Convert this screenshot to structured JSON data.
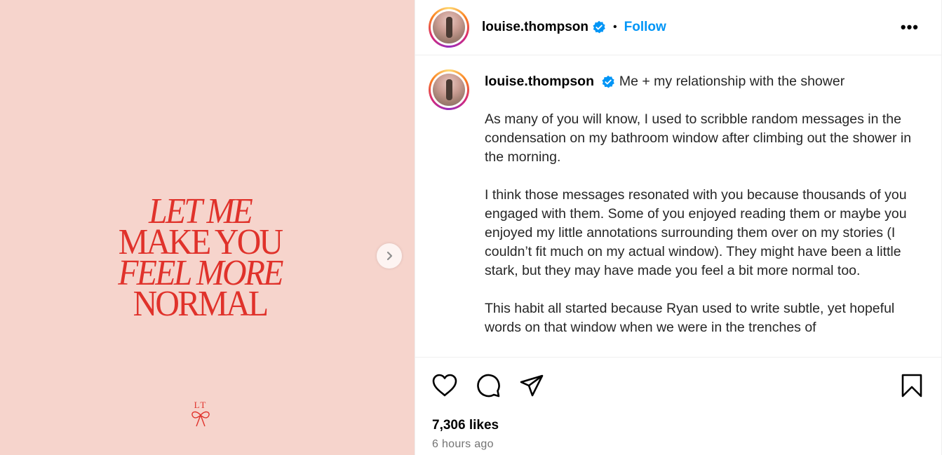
{
  "media": {
    "headline_lines": [
      "LET ME",
      "MAKE YOU",
      "FEEL MORE",
      "NORMAL"
    ],
    "monogram": "LT",
    "colors": {
      "background": "#f6d4cc",
      "text": "#e0322b"
    },
    "next_icon": "chevron-right-icon"
  },
  "header": {
    "username": "louise.thompson",
    "verified_icon": "verified-badge-icon",
    "separator": "•",
    "follow_label": "Follow",
    "more_label": "•••"
  },
  "caption": {
    "username": "louise.thompson",
    "title": "Me + my relationship with the shower",
    "paragraphs": [
      "As many of you will know, I used to scribble random messages in the condensation on my bathroom window after climbing out the shower in the morning.",
      "I think those messages resonated with you because thousands of you engaged with them. Some of you enjoyed reading them or maybe you enjoyed my little annotations surrounding them over on my stories (I couldn’t fit much on my actual window). They might have been a little stark, but they may have made you feel a bit more normal too.",
      "This habit all started because Ryan used to write subtle, yet hopeful words on that window when we were in the trenches of"
    ]
  },
  "actions": {
    "like_icon": "heart-icon",
    "comment_icon": "comment-icon",
    "share_icon": "share-icon",
    "save_icon": "bookmark-icon",
    "likes": "7,306 likes",
    "time": "6 hours ago"
  },
  "colors": {
    "accent": "#0095f6",
    "muted": "#737373",
    "border": "#efefef"
  }
}
